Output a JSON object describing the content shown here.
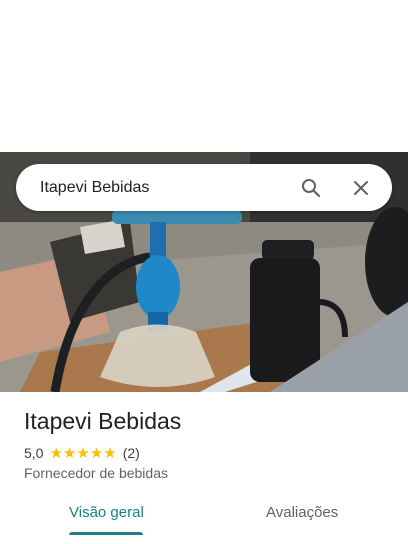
{
  "search": {
    "query": "Itapevi Bebidas"
  },
  "icons": {
    "search": "search-icon",
    "close": "close-icon",
    "star": "star-icon"
  },
  "place": {
    "name": "Itapevi Bebidas",
    "rating": "5,0",
    "stars": "★★★★★",
    "review_count": "(2)",
    "category": "Fornecedor de bebidas"
  },
  "tabs": [
    {
      "label": "Visão geral",
      "active": true
    },
    {
      "label": "Avaliações",
      "active": false
    }
  ],
  "colors": {
    "accent": "#1a7f86",
    "star": "#fbbc04"
  }
}
